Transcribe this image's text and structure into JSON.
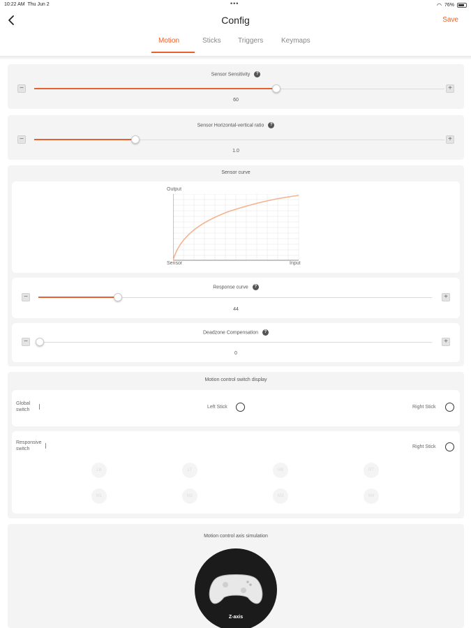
{
  "status": {
    "time": "10:22 AM",
    "date": "Thu Jun 2",
    "battery": "76%",
    "dots": "•••"
  },
  "header": {
    "title": "Config",
    "save_label": "Save"
  },
  "tabs": [
    {
      "label": "Motion",
      "active": true
    },
    {
      "label": "Sticks",
      "active": false
    },
    {
      "label": "Triggers",
      "active": false
    },
    {
      "label": "Keymaps",
      "active": false
    }
  ],
  "accent_color": "#e8612c",
  "sensor_sensitivity": {
    "label": "Sensor Sensitivity",
    "value": "60",
    "fraction": 0.6,
    "help": "?"
  },
  "sensor_ratio": {
    "label": "Sensor Horizontal-vertical ratio",
    "value": "1.0",
    "fraction": 0.25,
    "help": "?"
  },
  "sensor_curve": {
    "label": "Sensor curve",
    "chart": {
      "y_label": "Output",
      "x_label_left": "Sensor",
      "x_label_right": "Input"
    },
    "response_curve": {
      "label": "Response curve",
      "value": "44",
      "fraction": 0.2,
      "help": "?"
    },
    "deadzone": {
      "label": "Deadzone Compensation",
      "value": "0",
      "fraction": 0.0,
      "help": "?"
    }
  },
  "switch_display": {
    "label": "Motion control switch display",
    "global": {
      "label_line1": "Global",
      "label_line2": "switch",
      "left_stick": "Left Stick",
      "right_stick": "Right Stick"
    },
    "responsive": {
      "label_line1": "Responsive",
      "label_line2": "switch",
      "right_stick": "Right Stick",
      "buttons_row1": [
        "LB",
        "LT",
        "RB",
        "RT"
      ],
      "buttons_row2": [
        "M1",
        "M2",
        "M3",
        "M4"
      ]
    }
  },
  "axis_simulation": {
    "label": "Motion control axis simulation",
    "axis": "Z-axis"
  }
}
